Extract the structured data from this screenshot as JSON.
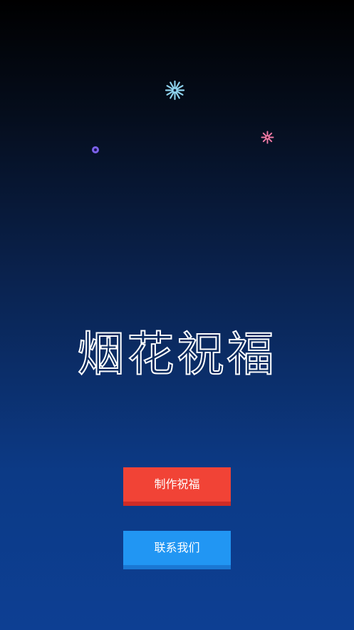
{
  "app": {
    "title": "烟花祝福"
  },
  "buttons": {
    "make_label": "制作祝福",
    "contact_label": "联系我们"
  },
  "decorations": {
    "fireworks": [
      {
        "name": "firework-cyan-icon",
        "color": "#8fd3ee"
      },
      {
        "name": "firework-pink-icon",
        "color": "#f07aa6"
      },
      {
        "name": "firework-purple-icon",
        "color": "#7b61e8"
      }
    ]
  },
  "colors": {
    "background_top": "#000000",
    "background_bottom": "#0d3f93",
    "make_button": "#f14336",
    "contact_button": "#2196f3"
  }
}
